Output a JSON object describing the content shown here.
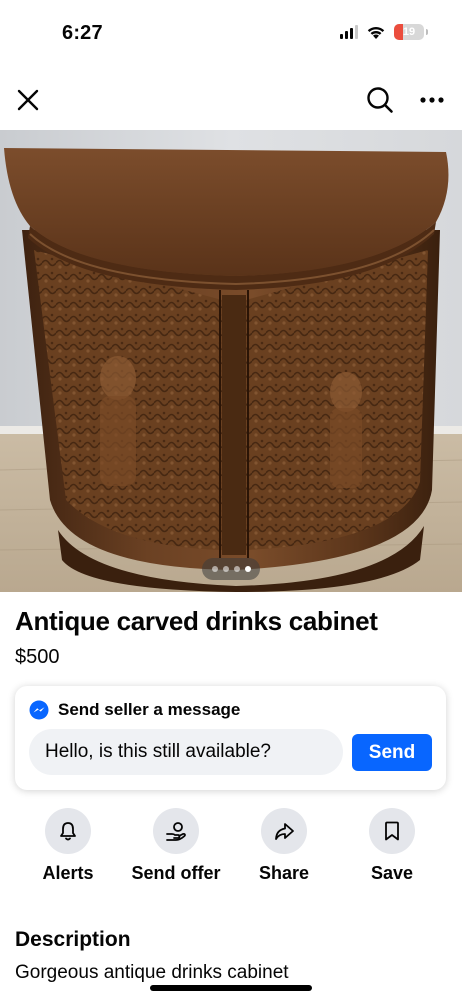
{
  "status_bar": {
    "time": "6:27",
    "battery_level": "19",
    "battery_color": "#eb4d3d",
    "icons": [
      "signal-icon",
      "wifi-icon",
      "battery-icon"
    ]
  },
  "nav": {
    "icons": [
      "close-icon",
      "search-icon",
      "more-icon"
    ]
  },
  "photo": {
    "subject": "carved wooden demilune drinks cabinet",
    "carousel_total": 4,
    "carousel_active": 4
  },
  "listing": {
    "title": "Antique carved drinks cabinet",
    "price": "$500"
  },
  "message": {
    "header": "Send seller a message",
    "input_value": "Hello, is this still available?",
    "send_label": "Send",
    "accent_color": "#0866ff"
  },
  "actions": [
    {
      "label": "Alerts",
      "icon": "bell-icon"
    },
    {
      "label": "Send offer",
      "icon": "offer-icon"
    },
    {
      "label": "Share",
      "icon": "share-icon"
    },
    {
      "label": "Save",
      "icon": "bookmark-icon"
    }
  ],
  "description": {
    "title": "Description",
    "text": "Gorgeous antique drinks cabinet"
  }
}
